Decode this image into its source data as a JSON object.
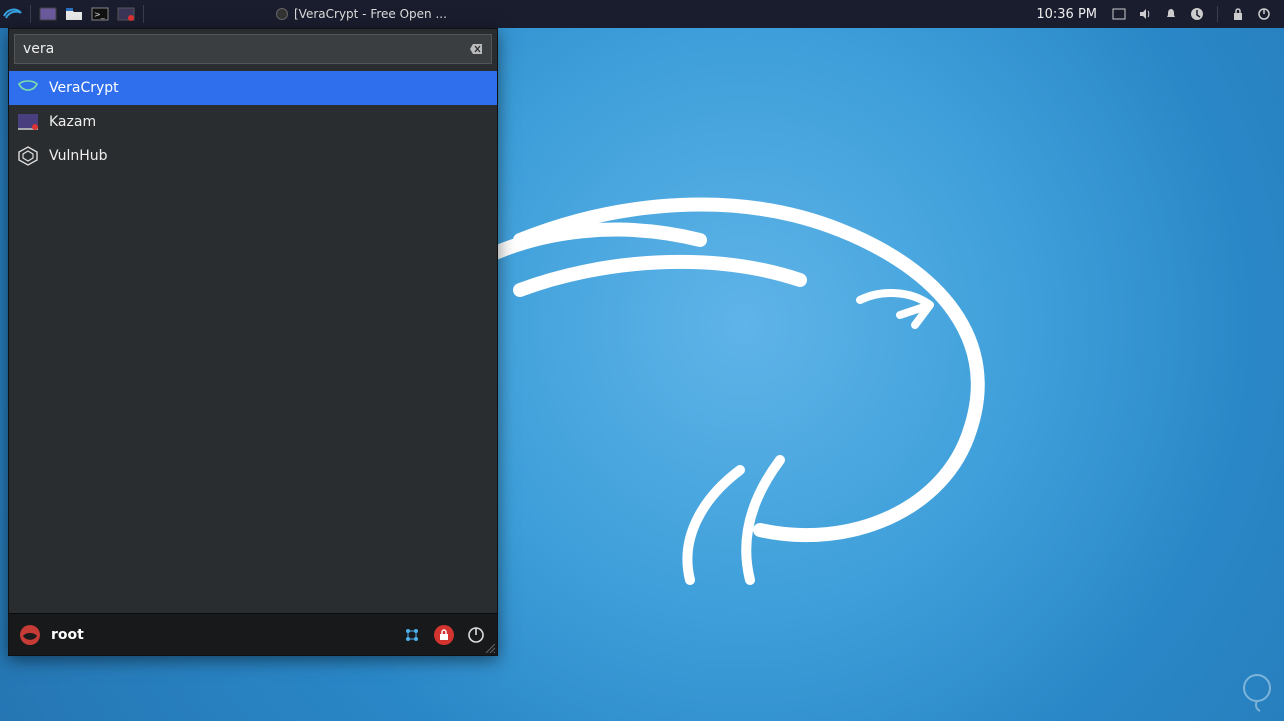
{
  "panel": {
    "taskbar_title": "[VeraCrypt - Free Open ...",
    "clock": "10:36 PM"
  },
  "menu": {
    "search_value": "vera",
    "results": [
      {
        "label": "VeraCrypt",
        "icon": "veracrypt"
      },
      {
        "label": "Kazam",
        "icon": "kazam"
      },
      {
        "label": "VulnHub",
        "icon": "vulnhub"
      }
    ],
    "user": "root"
  }
}
